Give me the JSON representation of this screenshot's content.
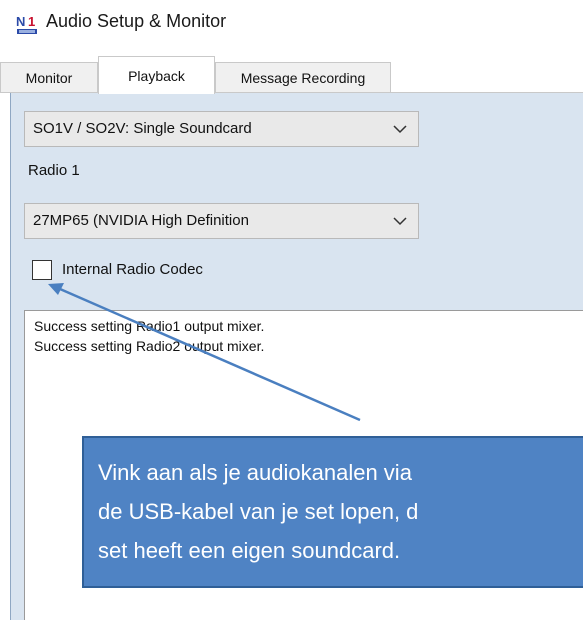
{
  "window": {
    "title": "Audio Setup & Monitor",
    "icon": "app-logo-icon"
  },
  "tabs": [
    {
      "label": "Monitor"
    },
    {
      "label": "Playback"
    },
    {
      "label": "Message Recording"
    }
  ],
  "active_tab": "Playback",
  "playback": {
    "mode_select": {
      "value": "SO1V / SO2V: Single Soundcard"
    },
    "radio_label": "Radio 1",
    "device_select": {
      "value": "27MP65 (NVIDIA High Definition"
    },
    "internal_codec": {
      "label": "Internal Radio Codec",
      "checked": false
    },
    "log_lines": [
      "Success setting Radio1 output mixer.",
      "Success setting Radio2 output mixer."
    ]
  },
  "callout": {
    "lines": [
      "Vink aan als je audiokanalen via",
      "de USB-kabel van je set lopen, d",
      "set heeft een eigen soundcard."
    ]
  },
  "colors": {
    "panel_bg": "#d9e4f0",
    "callout_bg": "#4f83c4",
    "arrow": "#4a7fc0"
  }
}
